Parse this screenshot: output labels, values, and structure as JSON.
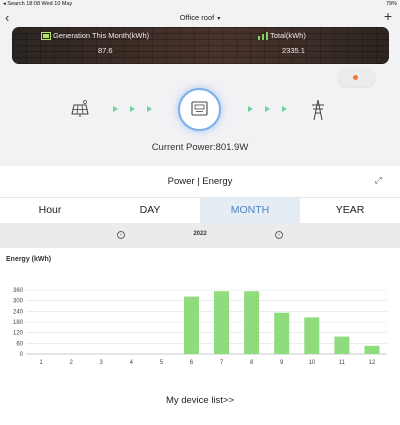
{
  "status": {
    "left": "◂ Search  18:08  Wed 10 May",
    "right": "79%"
  },
  "nav": {
    "back_icon": "chevron-left-icon",
    "title": "Office roof",
    "title_caret": "▾",
    "add": "+"
  },
  "banner": {
    "generation_label": "Generation This Month(kWh)",
    "generation_value": "87.6",
    "total_label": "Total(kWh)",
    "total_value": "2335.1"
  },
  "current_power": "Current Power:801.9W",
  "section": {
    "title": "Power | Energy",
    "tabs": [
      "Hour",
      "DAY",
      "MONTH",
      "YEAR"
    ],
    "active_tab": 2,
    "year": "2022",
    "prev": "‹",
    "next": "›"
  },
  "chart_data": {
    "type": "bar",
    "ylabel": "Energy (kWh)",
    "categories": [
      "1",
      "2",
      "3",
      "4",
      "5",
      "6",
      "7",
      "8",
      "9",
      "10",
      "11",
      "12"
    ],
    "values": [
      0,
      0,
      0,
      0,
      0,
      323,
      353,
      353,
      232,
      206,
      98,
      46
    ],
    "ylim": [
      0,
      360
    ],
    "yticks": [
      0,
      60,
      120,
      180,
      240,
      300,
      360
    ],
    "grid": true,
    "bar_color": "#8fdc7e"
  },
  "device_list": "My device list>>"
}
